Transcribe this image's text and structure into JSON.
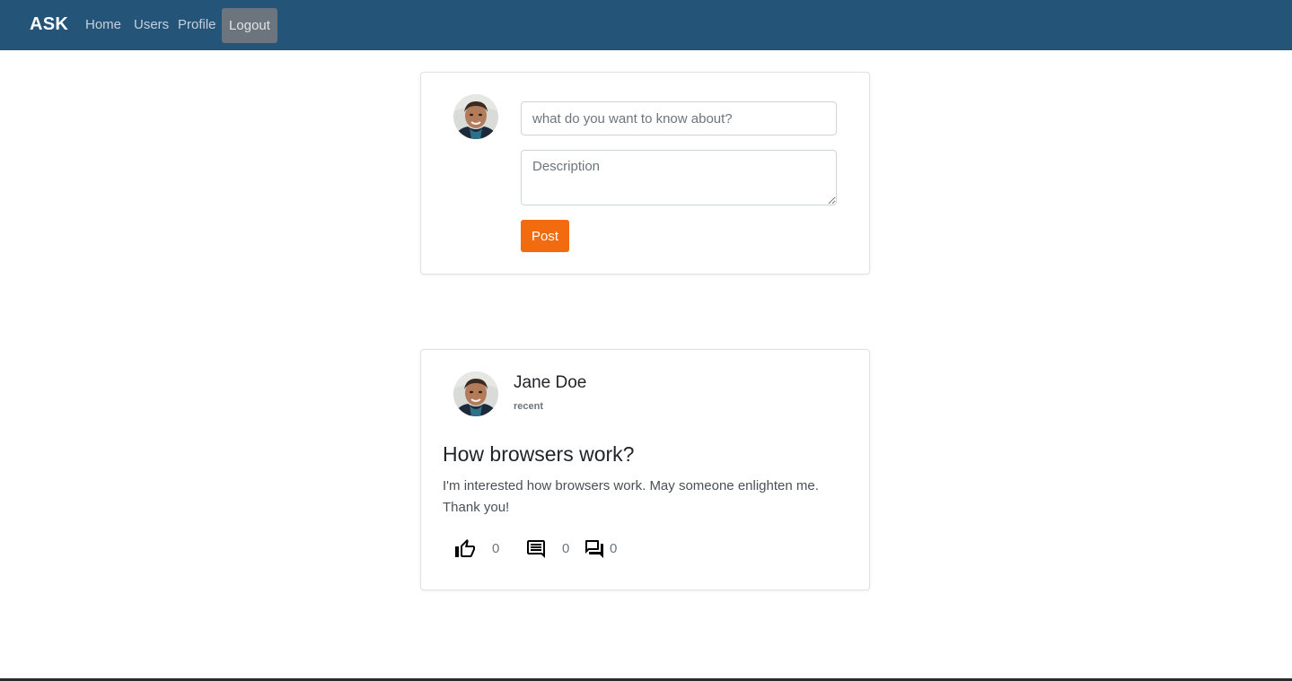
{
  "navbar": {
    "brand": "ASK",
    "links": [
      "Home",
      "Users",
      "Profile"
    ],
    "logout": "Logout",
    "bg_color": "#245579"
  },
  "compose": {
    "title_placeholder": "what do you want to know about?",
    "description_placeholder": "Description",
    "post_label": "Post",
    "post_color": "#f26b0f"
  },
  "post": {
    "author": "Jane Doe",
    "meta": "recent",
    "title": "How browsers work?",
    "body": "I'm interested how browsers work. May someone enlighten me. Thank you!",
    "likes": "0",
    "comments": "0",
    "answers": "0",
    "icons": [
      "thumb-up-icon",
      "comment-icon",
      "answers-icon"
    ]
  }
}
